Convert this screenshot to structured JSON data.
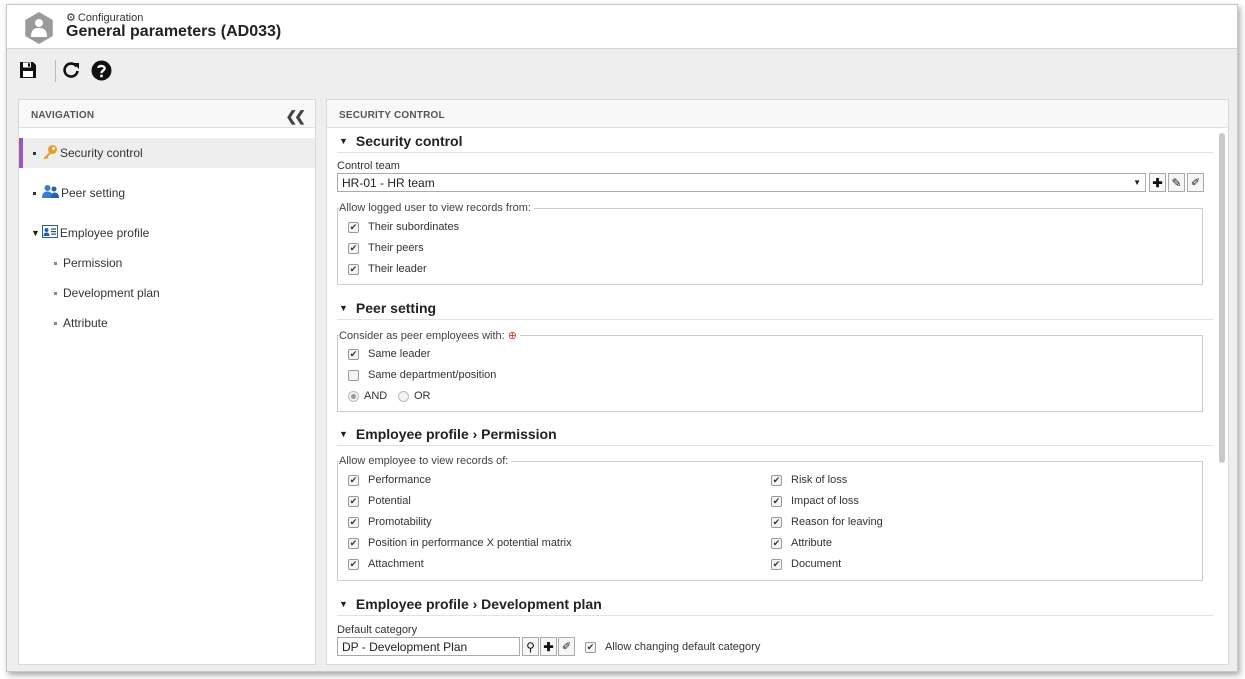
{
  "header": {
    "breadcrumb": "Configuration",
    "title": "General parameters (AD033)"
  },
  "toolbar": {
    "save_icon": "floppy-disk-icon",
    "refresh_icon": "refresh-icon",
    "help_icon": "help-icon"
  },
  "navigation": {
    "heading": "NAVIGATION",
    "items": [
      {
        "label": "Security control",
        "icon": "key-icon",
        "active": true
      },
      {
        "label": "Peer setting",
        "icon": "users-icon"
      },
      {
        "label": "Employee profile",
        "icon": "profile-card-icon",
        "expanded": true
      },
      {
        "label": "Permission"
      },
      {
        "label": "Development plan"
      },
      {
        "label": "Attribute"
      }
    ]
  },
  "main": {
    "heading": "SECURITY CONTROL",
    "security": {
      "title": "Security control",
      "control_team_label": "Control team",
      "control_team_value": "HR-01 - HR team",
      "group_legend": "Allow logged user to view records from:",
      "options": [
        {
          "label": "Their subordinates",
          "checked": true
        },
        {
          "label": "Their peers",
          "checked": true
        },
        {
          "label": "Their leader",
          "checked": true
        }
      ]
    },
    "peer": {
      "title": "Peer setting",
      "group_legend": "Consider as peer employees with:",
      "options": [
        {
          "label": "Same leader",
          "checked": true
        },
        {
          "label": "Same department/position",
          "checked": false
        }
      ],
      "radio_and": "AND",
      "radio_or": "OR"
    },
    "permission": {
      "title": "Employee profile › Permission",
      "group_legend": "Allow employee to view records of:",
      "left": [
        {
          "label": "Performance",
          "checked": true
        },
        {
          "label": "Potential",
          "checked": true
        },
        {
          "label": "Promotability",
          "checked": true
        },
        {
          "label": "Position in performance X potential matrix",
          "checked": true
        },
        {
          "label": "Attachment",
          "checked": true
        }
      ],
      "right": [
        {
          "label": "Risk of loss",
          "checked": true
        },
        {
          "label": "Impact of loss",
          "checked": true
        },
        {
          "label": "Reason for leaving",
          "checked": true
        },
        {
          "label": "Attribute",
          "checked": true
        },
        {
          "label": "Document",
          "checked": true
        }
      ]
    },
    "devplan": {
      "title": "Employee profile › Development plan",
      "default_category_label": "Default category",
      "default_category_value": "DP - Development Plan",
      "allow_change_label": "Allow changing default category",
      "allow_change_checked": true
    }
  },
  "colors": {
    "accent_active": "#9b59b6",
    "key_icon": "#e0a030",
    "users_icon": "#3a7bd5"
  }
}
